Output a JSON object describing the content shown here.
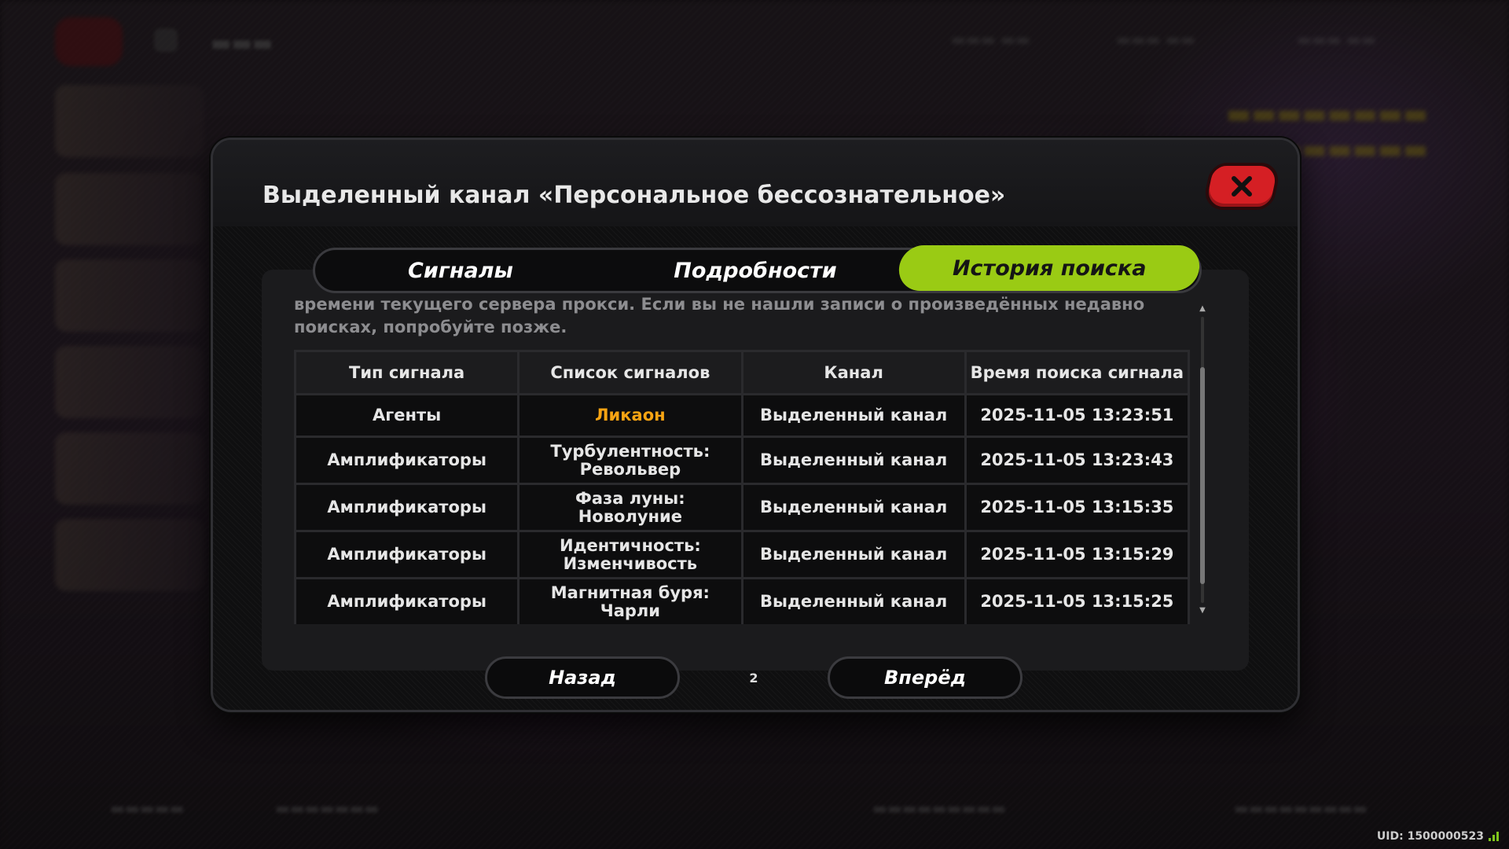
{
  "modal": {
    "title": "Выделенный канал «Персональное бессознательное»",
    "tabs": [
      "Сигналы",
      "Подробности",
      "История поиска"
    ],
    "active_tab": "История поиска",
    "note": "времени текущего сервера прокси. Если вы не нашли записи о произведённых недавно поисках, попробуйте позже.",
    "table": {
      "headers": [
        "Тип сигнала",
        "Список сигналов",
        "Канал",
        "Время поиска сигнала"
      ],
      "rows": [
        {
          "type": "Агенты",
          "signal": "Ликаон",
          "channel": "Выделенный канал",
          "time": "2025-11-05 13:23:51"
        },
        {
          "type": "Амплификаторы",
          "signal": "Турбулентность: Револьвер",
          "channel": "Выделенный канал",
          "time": "2025-11-05 13:23:43"
        },
        {
          "type": "Амплификаторы",
          "signal": "Фаза луны: Новолуние",
          "channel": "Выделенный канал",
          "time": "2025-11-05 13:15:35"
        },
        {
          "type": "Амплификаторы",
          "signal": "Идентичность: Изменчивость",
          "channel": "Выделенный канал",
          "time": "2025-11-05 13:15:29"
        },
        {
          "type": "Амплификаторы",
          "signal": "Магнитная буря: Чарли",
          "channel": "Выделенный канал",
          "time": "2025-11-05 13:15:25"
        }
      ]
    },
    "pager": {
      "prev": "Назад",
      "page": "2",
      "next": "Вперёд"
    }
  },
  "footer": {
    "uid": "UID: 1500000523"
  },
  "colors": {
    "accent_green": "#9acb14",
    "highlight_orange": "#f7a413",
    "close_red": "#d51f24"
  }
}
